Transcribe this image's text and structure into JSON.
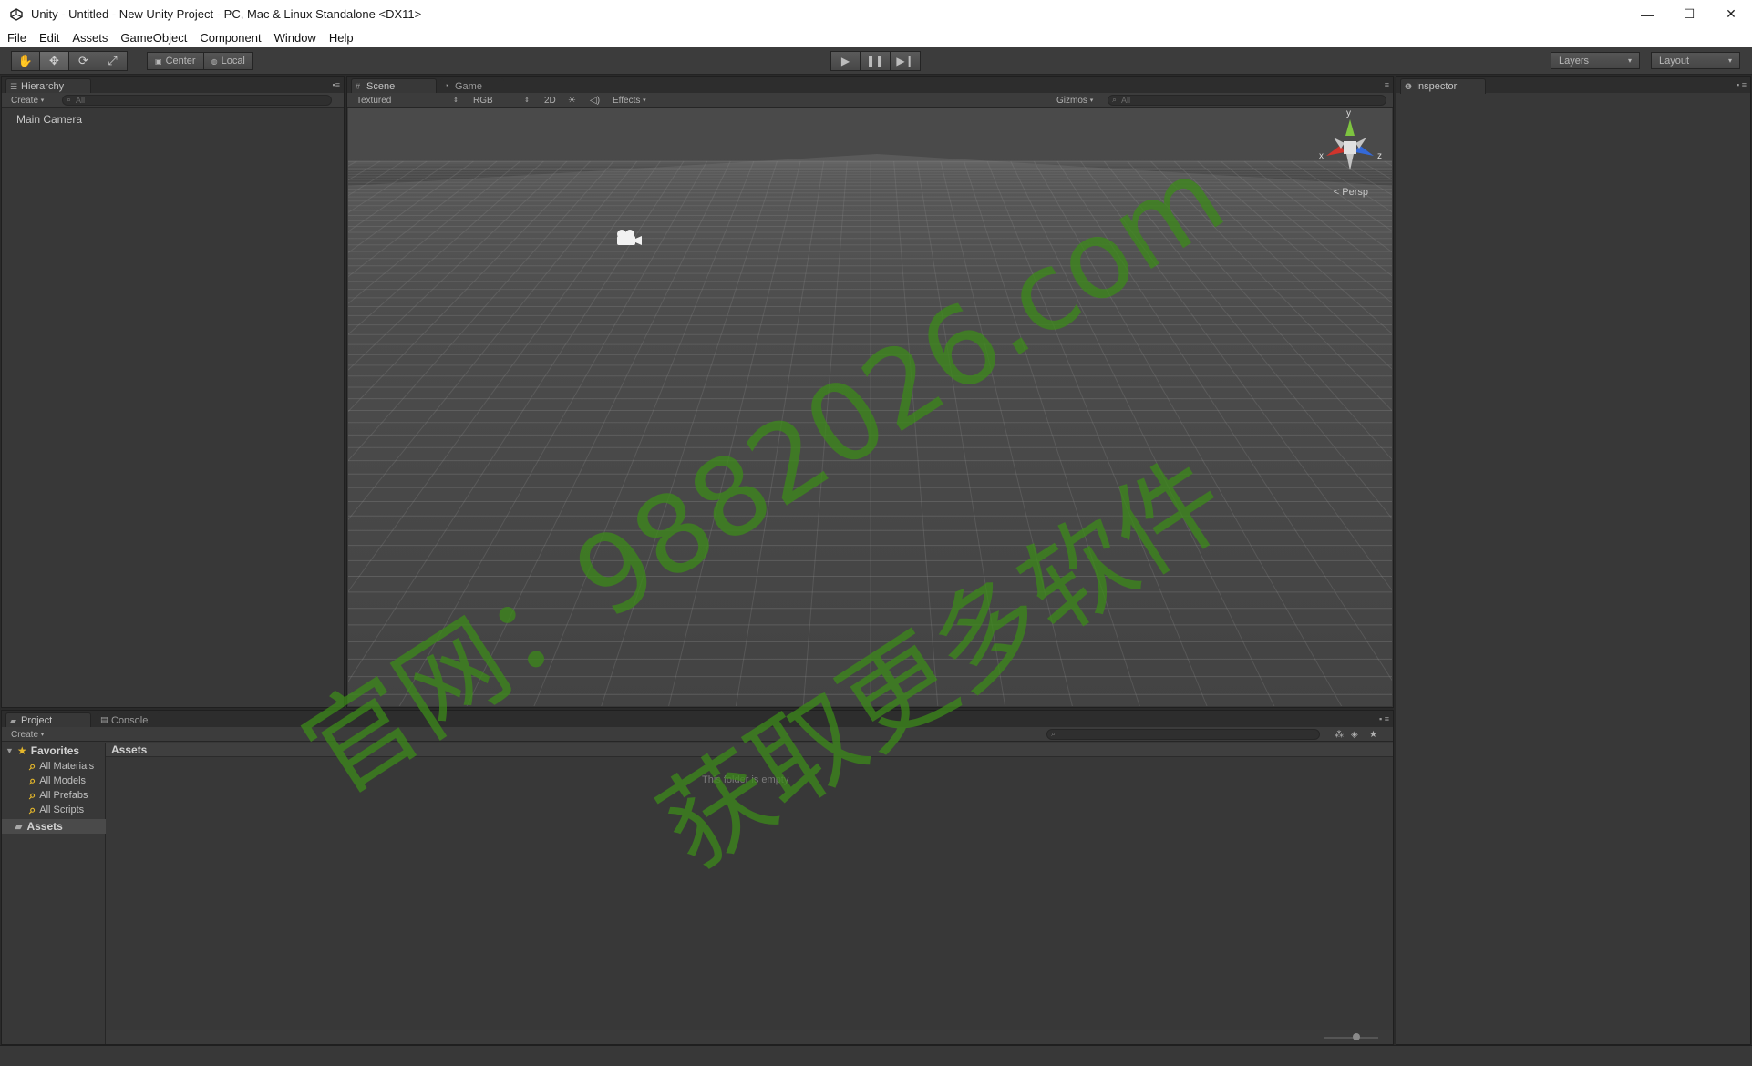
{
  "window": {
    "title": "Unity - Untitled - New Unity Project - PC, Mac & Linux Standalone <DX11>",
    "controls": {
      "minimize": "—",
      "maximize": "☐",
      "close": "✕"
    }
  },
  "menu": [
    "File",
    "Edit",
    "Assets",
    "GameObject",
    "Component",
    "Window",
    "Help"
  ],
  "toolbar": {
    "pivot": "Center",
    "space": "Local",
    "layers": "Layers",
    "layout": "Layout"
  },
  "hierarchy": {
    "tab": "Hierarchy",
    "create": "Create",
    "search_placeholder": "All",
    "items": [
      "Main Camera"
    ]
  },
  "scene": {
    "tabs": [
      "Scene",
      "Game"
    ],
    "shading": "Textured",
    "render_mode": "RGB",
    "toggle_2d": "2D",
    "effects": "Effects",
    "gizmos": "Gizmos",
    "search_placeholder": "All",
    "persp": "Persp",
    "axis_labels": {
      "x": "x",
      "y": "y",
      "z": "z"
    }
  },
  "inspector": {
    "tab": "Inspector"
  },
  "project": {
    "tabs": [
      "Project",
      "Console"
    ],
    "create": "Create",
    "favorites_label": "Favorites",
    "favorites": [
      "All Materials",
      "All Models",
      "All Prefabs",
      "All Scripts"
    ],
    "assets_label": "Assets",
    "breadcrumb": "Assets",
    "empty_message": "This folder is empty"
  },
  "watermark": {
    "line1": "官网：9882026.com",
    "line2": "获取更多软件",
    "color": "#3c8a1a"
  }
}
